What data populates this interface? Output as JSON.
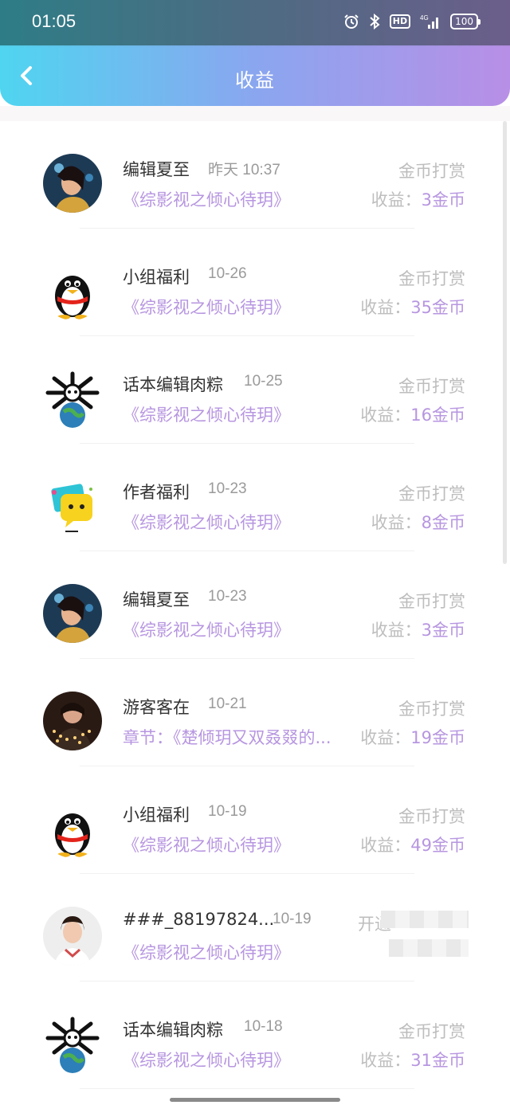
{
  "status": {
    "time": "01:05",
    "battery": "100",
    "hd": "HD",
    "network": "4G"
  },
  "header": {
    "title": "收益"
  },
  "earn_prefix": "收益：",
  "items": [
    {
      "name": "编辑夏至",
      "date": "昨天 10:37",
      "work": "《综影视之倾心待玥》",
      "type": "金币打赏",
      "amount": "3金币",
      "avatar": "photo-woman-avatar"
    },
    {
      "name": "小组福利",
      "date": "10-26",
      "work": "《综影视之倾心待玥》",
      "type": "金币打赏",
      "amount": "35金币",
      "avatar": "penguin-avatar"
    },
    {
      "name": "话本编辑肉粽",
      "date": "10-25",
      "work": "《综影视之倾心待玥》",
      "type": "金币打赏",
      "amount": "16金币",
      "avatar": "panda-globe-avatar"
    },
    {
      "name": "作者福利",
      "date": "10-23",
      "work": "《综影视之倾心待玥》",
      "type": "金币打赏",
      "amount": "8金币",
      "avatar": "chat-bubble-avatar"
    },
    {
      "name": "编辑夏至",
      "date": "10-23",
      "work": "《综影视之倾心待玥》",
      "type": "金币打赏",
      "amount": "3金币",
      "avatar": "photo-woman-avatar"
    },
    {
      "name": "游客客在",
      "date": "10-21",
      "work": "章节：《楚倾玥又双叒叕的...",
      "type": "金币打赏",
      "amount": "19金币",
      "avatar": "photo-lights-avatar"
    },
    {
      "name": "小组福利",
      "date": "10-19",
      "work": "《综影视之倾心待玥》",
      "type": "金币打赏",
      "amount": "49金币",
      "avatar": "penguin-avatar"
    },
    {
      "name": "###_88197824...",
      "date": "10-19",
      "work": "《综影视之倾心待玥》",
      "type": "开通",
      "amount": "",
      "avatar": "photo-girl-avatar"
    },
    {
      "name": "话本编辑肉粽",
      "date": "10-18",
      "work": "《综影视之倾心待玥》",
      "type": "金币打赏",
      "amount": "31金币",
      "avatar": "panda-globe-avatar"
    }
  ]
}
